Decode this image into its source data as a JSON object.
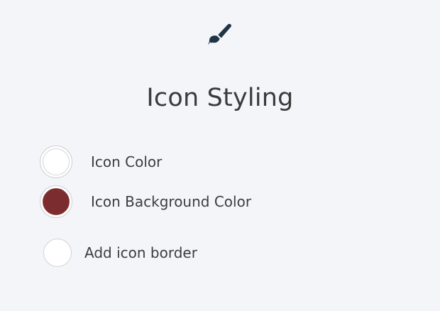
{
  "panel": {
    "title": "Icon Styling",
    "header_icon": "paintbrush-icon",
    "icon_color": {
      "label": "Icon Color",
      "value": "#ffffff"
    },
    "icon_background_color": {
      "label": "Icon Background Color",
      "value": "#7a2c2f"
    },
    "border_option": {
      "label": "Add icon border",
      "checked": false
    },
    "colors": {
      "page_background": "#f4f5f9",
      "icon": "#1f3546",
      "text": "#3d3d3d"
    }
  }
}
